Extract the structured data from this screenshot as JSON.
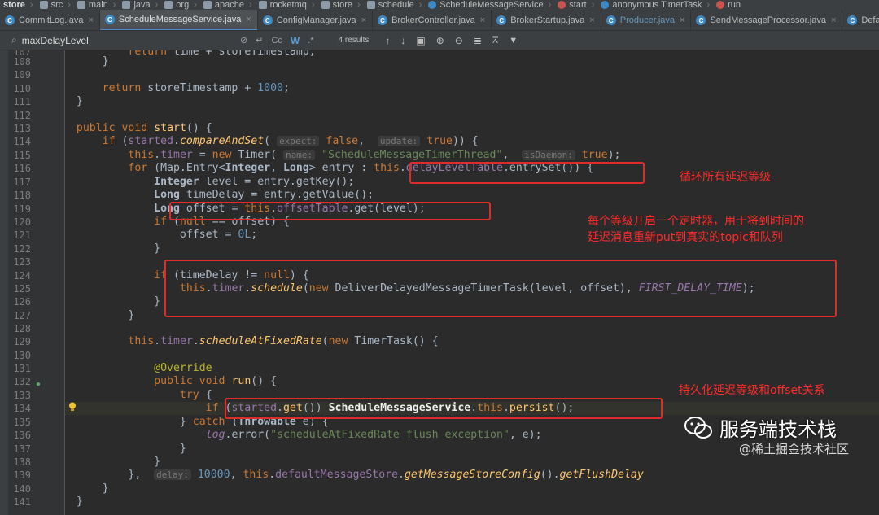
{
  "breadcrumb": [
    {
      "label": "store",
      "bold": true,
      "icon": "folder-icon"
    },
    {
      "label": "src",
      "icon": "folder-icon"
    },
    {
      "label": "main",
      "icon": "folder-icon"
    },
    {
      "label": "java",
      "icon": "folder-icon"
    },
    {
      "label": "org",
      "icon": "folder-icon"
    },
    {
      "label": "apache",
      "icon": "folder-icon"
    },
    {
      "label": "rocketmq",
      "icon": "folder-icon"
    },
    {
      "label": "store",
      "icon": "folder-icon"
    },
    {
      "label": "schedule",
      "icon": "folder-icon"
    },
    {
      "label": "ScheduleMessageService",
      "icon": "class-icon"
    },
    {
      "label": "start",
      "icon": "method-icon"
    },
    {
      "label": "anonymous TimerTask",
      "icon": "class-icon"
    },
    {
      "label": "run",
      "icon": "method-icon"
    }
  ],
  "tabs": [
    {
      "label": "CommitLog.java",
      "active": false,
      "modified": false
    },
    {
      "label": "ScheduleMessageService.java",
      "active": true,
      "modified": false
    },
    {
      "label": "ConfigManager.java",
      "active": false,
      "modified": false
    },
    {
      "label": "BrokerController.java",
      "active": false,
      "modified": false
    },
    {
      "label": "BrokerStartup.java",
      "active": false,
      "modified": false
    },
    {
      "label": "Producer.java",
      "active": false,
      "modified": true
    },
    {
      "label": "SendMessageProcessor.java",
      "active": false,
      "modified": false
    },
    {
      "label": "DefaultMessageStore.ja",
      "active": false,
      "modified": false
    }
  ],
  "search": {
    "query": "maxDelayLevel",
    "opt_case": "Cc",
    "opt_word": "W",
    "opt_regex": ".*",
    "results": "4 results"
  },
  "line_numbers": [
    "107",
    "108",
    "109",
    "110",
    "111",
    "112",
    "113",
    "114",
    "115",
    "116",
    "117",
    "118",
    "119",
    "120",
    "121",
    "122",
    "123",
    "124",
    "125",
    "126",
    "127",
    "128",
    "129",
    "130",
    "131",
    "132",
    "133",
    "134",
    "135",
    "136",
    "137",
    "138",
    "139",
    "140",
    "141"
  ],
  "notes": {
    "loop": "循环所有延迟等级",
    "timer_1": "每个等级开启一个定时器，用于将到时间的",
    "timer_2": "延迟消息重新put到真实的topic和队列",
    "persist": "持久化延迟等级和offset关系"
  },
  "watermark": {
    "name": "服务端技术栈",
    "site": "@稀土掘金技术社区"
  },
  "colors": {
    "background": "#2b2b2b",
    "keyword": "#cc7832",
    "method": "#ffc66d",
    "number": "#6897bb",
    "string": "#6a8759",
    "field": "#9876aa",
    "annotation_red": "#e02b2b"
  }
}
